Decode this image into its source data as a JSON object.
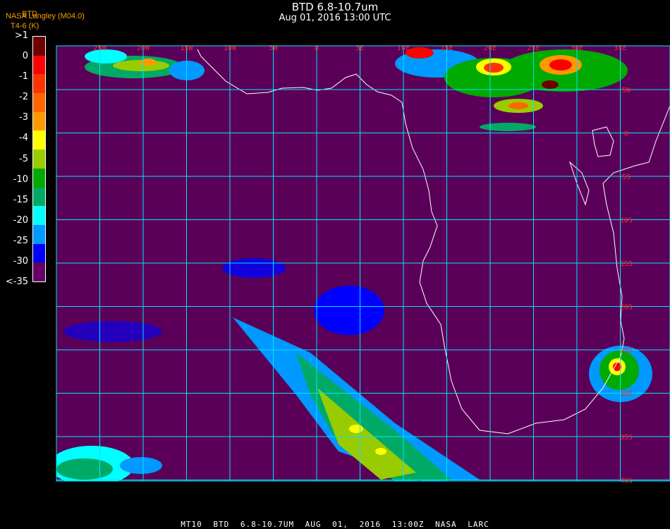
{
  "header": {
    "title": "BTD 6.8-10.7um",
    "subtitle": "Aug 01, 2016 13:00 UTC",
    "producer": "NASA Langley (M04.0)",
    "band_label": "BTD",
    "unit_label": "T4-6 (K)"
  },
  "legend": {
    "labels": [
      ">1",
      "0",
      "-1",
      "-2",
      "-3",
      "-4",
      "-5",
      "-10",
      "-15",
      "-20",
      "-25",
      "-30",
      "<-35"
    ],
    "colors": [
      "#6e0000",
      "#ff0000",
      "#ff3300",
      "#ff6600",
      "#ff9900",
      "#ffff00",
      "#99cc00",
      "#00aa00",
      "#00aa66",
      "#00ffff",
      "#0099ff",
      "#0000ff",
      "#660066"
    ]
  },
  "map": {
    "background_color": "#5a0058",
    "grid_color": "#00e5ff",
    "coast_color": "#ffffff",
    "label_color": "#ff2a2a",
    "lon_labels": [
      "25W",
      "20W",
      "15W",
      "10W",
      "5W",
      "0",
      "5E",
      "10E",
      "15E",
      "20E",
      "25E",
      "30E",
      "35E"
    ],
    "lat_labels": [
      "5N",
      "0",
      "5S",
      "10S",
      "15S",
      "20S",
      "25S",
      "30S",
      "35S",
      "40S"
    ]
  },
  "footer": "MT10 BTD 6.8-10.7UM AUG 01, 2016 13:00Z NASA LARC"
}
